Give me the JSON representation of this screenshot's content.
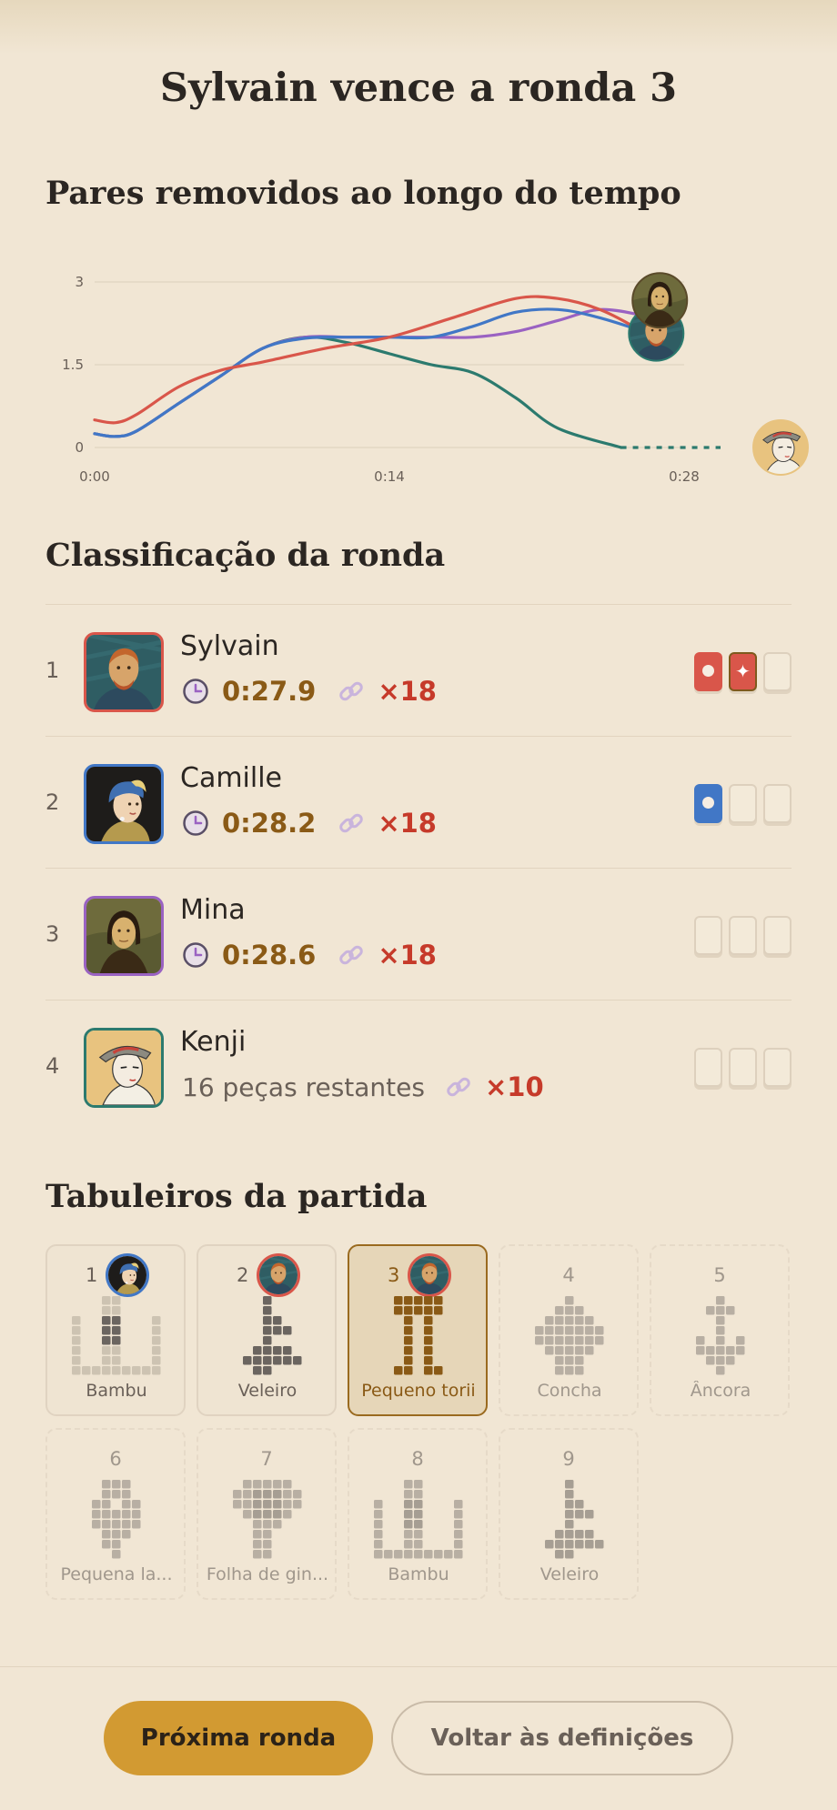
{
  "title": "Sylvain vence a ronda 3",
  "chart_section_title": "Pares removidos ao longo do tempo",
  "chart_data": {
    "type": "line",
    "title": "Pares removidos ao longo do tempo",
    "xlabel": "",
    "ylabel": "",
    "xlim": [
      0,
      28
    ],
    "ylim": [
      0,
      3
    ],
    "y_ticks": [
      "0",
      "1.5",
      "3"
    ],
    "x_ticks": [
      "0:00",
      "0:14",
      "0:28"
    ],
    "grid": true,
    "series": [
      {
        "player": "Sylvain",
        "color": "#d9564a",
        "x": [
          0,
          1,
          2,
          4,
          6,
          8,
          11,
          14,
          17,
          20,
          22,
          24,
          26,
          27
        ],
        "y": [
          0.5,
          0.45,
          0.6,
          1.1,
          1.4,
          1.55,
          1.8,
          2.0,
          2.35,
          2.7,
          2.7,
          2.5,
          2.1,
          1.8
        ]
      },
      {
        "player": "Camille",
        "color": "#4177c6",
        "x": [
          0,
          1,
          2,
          4,
          6,
          8,
          10,
          12,
          14,
          16,
          18,
          20,
          22,
          24,
          26.5
        ],
        "y": [
          0.25,
          0.2,
          0.3,
          0.8,
          1.3,
          1.8,
          1.98,
          2.0,
          2.0,
          2.0,
          2.2,
          2.45,
          2.5,
          2.35,
          2.05
        ]
      },
      {
        "player": "Mina",
        "color": "#9a62c2",
        "x": [
          0,
          1,
          2,
          4,
          6,
          8,
          10,
          12,
          14,
          16,
          18,
          20,
          22,
          24,
          26
        ],
        "y": [
          0.25,
          0.2,
          0.3,
          0.8,
          1.3,
          1.8,
          2.0,
          2.0,
          2.0,
          2.0,
          2.0,
          2.1,
          2.3,
          2.5,
          2.4
        ]
      },
      {
        "player": "Kenji",
        "color": "#2c7a6e",
        "x": [
          0,
          1,
          2,
          4,
          6,
          8,
          10,
          12,
          14,
          16,
          18,
          20,
          22,
          25,
          28
        ],
        "y": [
          0.25,
          0.2,
          0.3,
          0.8,
          1.3,
          1.8,
          2.0,
          1.9,
          1.7,
          1.5,
          1.35,
          0.9,
          0.35,
          0,
          0
        ]
      }
    ]
  },
  "ranking_section_title": "Classificação da ronda",
  "ranking": [
    {
      "position": "1",
      "name": "Sylvain",
      "avatar": "van-gogh-portrait",
      "border_color": "#d9564a",
      "time": "0:27.9",
      "remaining": "",
      "multiplier": "×18",
      "round_wins": [
        "win-red",
        "star-red",
        "empty"
      ]
    },
    {
      "position": "2",
      "name": "Camille",
      "avatar": "pearl-earring-portrait",
      "border_color": "#4177c6",
      "time": "0:28.2",
      "remaining": "",
      "multiplier": "×18",
      "round_wins": [
        "win-blue",
        "empty",
        "empty"
      ]
    },
    {
      "position": "3",
      "name": "Mina",
      "avatar": "mona-lisa-portrait",
      "border_color": "#9a62c2",
      "time": "0:28.6",
      "remaining": "",
      "multiplier": "×18",
      "round_wins": [
        "empty",
        "empty",
        "empty"
      ]
    },
    {
      "position": "4",
      "name": "Kenji",
      "avatar": "ukiyo-e-portrait",
      "border_color": "#2c7a6e",
      "time": "",
      "remaining": "16 peças restantes",
      "multiplier": "×10",
      "round_wins": [
        "empty",
        "empty",
        "empty"
      ]
    }
  ],
  "boards_section_title": "Tabuleiros da partida",
  "boards": [
    {
      "number": "1",
      "label": "Bambu",
      "state": "played",
      "winner": "pearl-earring-portrait"
    },
    {
      "number": "2",
      "label": "Veleiro",
      "state": "played",
      "winner": "van-gogh-portrait"
    },
    {
      "number": "3",
      "label": "Pequeno torii",
      "state": "current",
      "winner": "van-gogh-portrait"
    },
    {
      "number": "4",
      "label": "Concha",
      "state": "future",
      "winner": ""
    },
    {
      "number": "5",
      "label": "Âncora",
      "state": "future",
      "winner": ""
    },
    {
      "number": "6",
      "label": "Pequena la...",
      "state": "future",
      "winner": ""
    },
    {
      "number": "7",
      "label": "Folha de gin...",
      "state": "future",
      "winner": ""
    },
    {
      "number": "8",
      "label": "Bambu",
      "state": "future",
      "winner": ""
    },
    {
      "number": "9",
      "label": "Veleiro",
      "state": "future",
      "winner": ""
    }
  ],
  "buttons": {
    "next": "Próxima ronda",
    "back": "Voltar às definições"
  }
}
